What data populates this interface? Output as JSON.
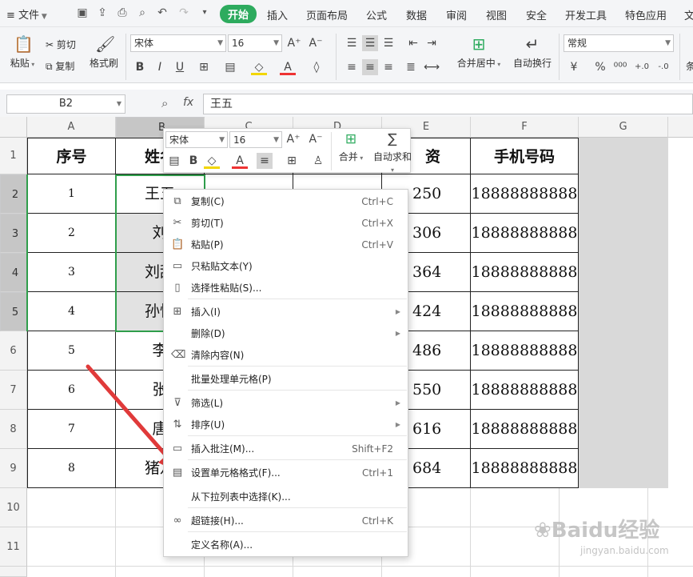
{
  "menubar": {
    "file_label": "文件",
    "tabs": [
      "开始",
      "插入",
      "页面布局",
      "公式",
      "数据",
      "审阅",
      "视图",
      "安全",
      "开发工具",
      "特色应用"
    ],
    "last_tab": "文"
  },
  "ribbon": {
    "paste": "粘贴",
    "cut": "剪切",
    "copy": "复制",
    "format_painter": "格式刷",
    "font_name": "宋体",
    "font_size": "16",
    "merge_center": "合并居中",
    "wrap_text": "自动换行",
    "number_format": "常规",
    "more_label": "条"
  },
  "formula_bar": {
    "name_box": "B2",
    "fx_label": "fx",
    "value": "王五"
  },
  "columns": [
    "A",
    "B",
    "C",
    "D",
    "E",
    "F",
    "G"
  ],
  "rows": [
    "1",
    "2",
    "3",
    "4",
    "5",
    "6",
    "7",
    "8",
    "9",
    "10",
    "11"
  ],
  "table": {
    "headers": {
      "A": "序号",
      "B": "姓名",
      "E": "资",
      "F": "手机号码"
    },
    "rows": [
      {
        "A": "1",
        "B": "王五",
        "E": "250",
        "F": "18888888888"
      },
      {
        "A": "2",
        "B": "刘",
        "E": "306",
        "F": "18888888888"
      },
      {
        "A": "3",
        "B": "刘甜",
        "E": "364",
        "F": "18888888888"
      },
      {
        "A": "4",
        "B": "孙悟",
        "E": "424",
        "F": "18888888888"
      },
      {
        "A": "5",
        "B": "李",
        "E": "486",
        "F": "18888888888"
      },
      {
        "A": "6",
        "B": "张",
        "E": "550",
        "F": "18888888888"
      },
      {
        "A": "7",
        "B": "唐",
        "E": "616",
        "F": "18888888888"
      },
      {
        "A": "8",
        "B": "猪八",
        "E": "684",
        "F": "18888888888"
      }
    ]
  },
  "mini_toolbar": {
    "font_name": "宋体",
    "font_size": "16",
    "merge": "合并",
    "autosum": "自动求和"
  },
  "context_menu": {
    "items": [
      {
        "label": "复制(C)",
        "shortcut": "Ctrl+C",
        "icon": "copy-icon"
      },
      {
        "label": "剪切(T)",
        "shortcut": "Ctrl+X",
        "icon": "scissors-icon"
      },
      {
        "label": "粘贴(P)",
        "shortcut": "Ctrl+V",
        "icon": "paste-icon"
      },
      {
        "label": "只粘贴文本(Y)",
        "shortcut": "",
        "icon": "paste-text-icon"
      },
      {
        "label": "选择性粘贴(S)...",
        "shortcut": "",
        "icon": "paste-special-icon"
      },
      {
        "label": "插入(I)",
        "shortcut": "",
        "icon": "insert-icon"
      },
      {
        "label": "删除(D)",
        "shortcut": "",
        "icon": ""
      },
      {
        "label": "清除内容(N)",
        "shortcut": "",
        "icon": "eraser-icon"
      },
      {
        "label": "批量处理单元格(P)",
        "shortcut": "",
        "icon": ""
      },
      {
        "label": "筛选(L)",
        "shortcut": "",
        "icon": "filter-icon"
      },
      {
        "label": "排序(U)",
        "shortcut": "",
        "icon": "sort-icon"
      },
      {
        "label": "插入批注(M)...",
        "shortcut": "Shift+F2",
        "icon": "comment-icon"
      },
      {
        "label": "设置单元格格式(F)...",
        "shortcut": "Ctrl+1",
        "icon": "format-cells-icon"
      },
      {
        "label": "从下拉列表中选择(K)...",
        "shortcut": "",
        "icon": ""
      },
      {
        "label": "超链接(H)...",
        "shortcut": "Ctrl+K",
        "icon": "link-icon"
      },
      {
        "label": "定义名称(A)...",
        "shortcut": "",
        "icon": ""
      }
    ]
  },
  "watermark": {
    "brand": "Baidu经验",
    "url": "jingyan.baidu.com"
  },
  "colors": {
    "accent_green": "#2dab5e",
    "annotation_arrow": "#e03a3a",
    "selection_border": "#2f9e4b"
  }
}
